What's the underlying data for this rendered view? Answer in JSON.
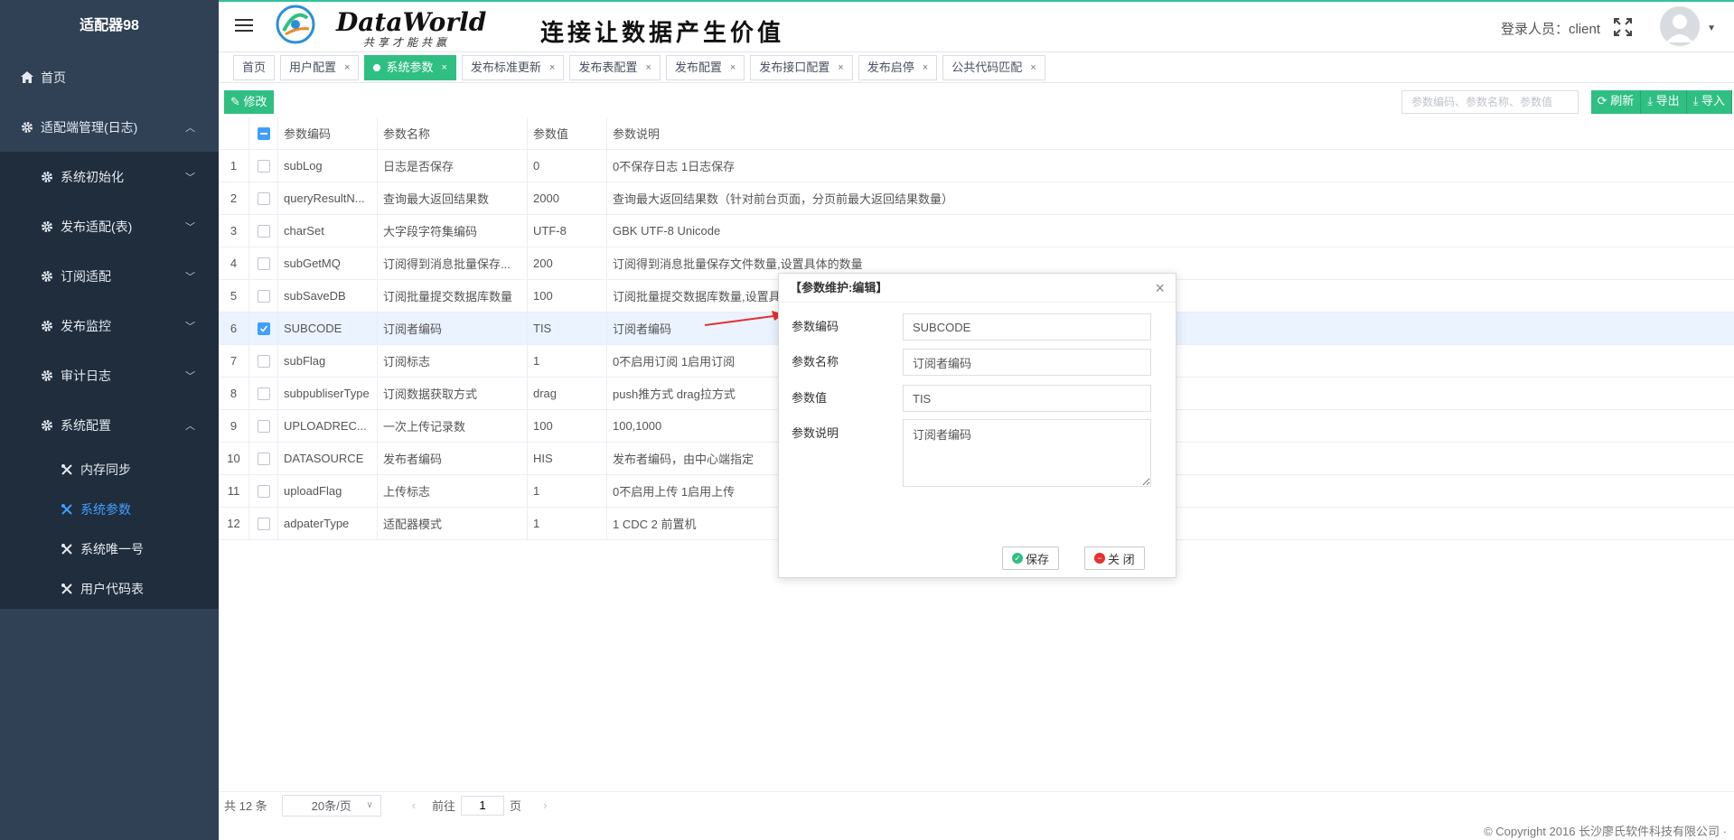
{
  "app": {
    "title": "适配器98"
  },
  "sidebar": {
    "home": "首页",
    "adapter_mgmt": "适配端管理(日志)",
    "sub": [
      "系统初始化",
      "发布适配(表)",
      "订阅适配",
      "发布监控",
      "审计日志",
      "系统配置"
    ],
    "config_items": [
      "内存同步",
      "系统参数",
      "系统唯一号",
      "用户代码表"
    ]
  },
  "header": {
    "logo_text": "DataWorld",
    "logo_sub": "共享才能共赢",
    "slogan": "连接让数据产生价值",
    "login_label": "登录人员：",
    "login_user": "client"
  },
  "tabs": [
    {
      "label": "首页",
      "closable": false,
      "active": false
    },
    {
      "label": "用户配置",
      "closable": true,
      "active": false
    },
    {
      "label": "系统参数",
      "closable": true,
      "active": true
    },
    {
      "label": "发布标准更新",
      "closable": true,
      "active": false
    },
    {
      "label": "发布表配置",
      "closable": true,
      "active": false
    },
    {
      "label": "发布配置",
      "closable": true,
      "active": false
    },
    {
      "label": "发布接口配置",
      "closable": true,
      "active": false
    },
    {
      "label": "发布启停",
      "closable": true,
      "active": false
    },
    {
      "label": "公共代码匹配",
      "closable": true,
      "active": false
    }
  ],
  "toolbar": {
    "edit": "修改",
    "search_placeholder": "参数编码、参数名称、参数值",
    "refresh": "刷新",
    "export": "导出",
    "import": "导入"
  },
  "table": {
    "headers": [
      "参数编码",
      "参数名称",
      "参数值",
      "参数说明"
    ],
    "rows": [
      {
        "idx": "1",
        "checked": false,
        "code": "subLog",
        "name": "日志是否保存",
        "value": "0",
        "desc": "0不保存日志 1日志保存"
      },
      {
        "idx": "2",
        "checked": false,
        "code": "queryResultN...",
        "name": "查询最大返回结果数",
        "value": "2000",
        "desc": "查询最大返回结果数（针对前台页面，分页前最大返回结果数量）"
      },
      {
        "idx": "3",
        "checked": false,
        "code": "charSet",
        "name": "大字段字符集编码",
        "value": "UTF-8",
        "desc": "GBK UTF-8 Unicode"
      },
      {
        "idx": "4",
        "checked": false,
        "code": "subGetMQ",
        "name": "订阅得到消息批量保存...",
        "value": "200",
        "desc": "订阅得到消息批量保存文件数量,设置具体的数量"
      },
      {
        "idx": "5",
        "checked": false,
        "code": "subSaveDB",
        "name": "订阅批量提交数据库数量",
        "value": "100",
        "desc": "订阅批量提交数据库数量,设置具"
      },
      {
        "idx": "6",
        "checked": true,
        "code": "SUBCODE",
        "name": "订阅者编码",
        "value": "TIS",
        "desc": "订阅者编码"
      },
      {
        "idx": "7",
        "checked": false,
        "code": "subFlag",
        "name": "订阅标志",
        "value": "1",
        "desc": "0不启用订阅 1启用订阅"
      },
      {
        "idx": "8",
        "checked": false,
        "code": "subpubliserType",
        "name": "订阅数据获取方式",
        "value": "drag",
        "desc": "push推方式 drag拉方式"
      },
      {
        "idx": "9",
        "checked": false,
        "code": "UPLOADREC...",
        "name": "一次上传记录数",
        "value": "100",
        "desc": "100,1000"
      },
      {
        "idx": "10",
        "checked": false,
        "code": "DATASOURCE",
        "name": "发布者编码",
        "value": "HIS",
        "desc": "发布者编码，由中心端指定"
      },
      {
        "idx": "11",
        "checked": false,
        "code": "uploadFlag",
        "name": "上传标志",
        "value": "1",
        "desc": "0不启用上传 1启用上传"
      },
      {
        "idx": "12",
        "checked": false,
        "code": "adpaterType",
        "name": "适配器模式",
        "value": "1",
        "desc": "1 CDC 2 前置机"
      }
    ]
  },
  "pagination": {
    "total": "共 12 条",
    "page_size": "20条/页",
    "goto_label": "前往",
    "page": "1",
    "page_unit": "页"
  },
  "footer": "© Copyright 2016 长沙廖氏软件科技有限公司 ·",
  "dialog": {
    "title": "【参数维护:编辑】",
    "code_label": "参数编码",
    "code_value": "SUBCODE",
    "name_label": "参数名称",
    "name_value": "订阅者编码",
    "value_label": "参数值",
    "value_value": "TIS",
    "desc_label": "参数说明",
    "desc_value": "订阅者编码",
    "save": "保存",
    "close": "关 闭"
  },
  "colors": {
    "sidebar": "#304156",
    "accent": "#2fbf82",
    "selected": "#409eff"
  }
}
